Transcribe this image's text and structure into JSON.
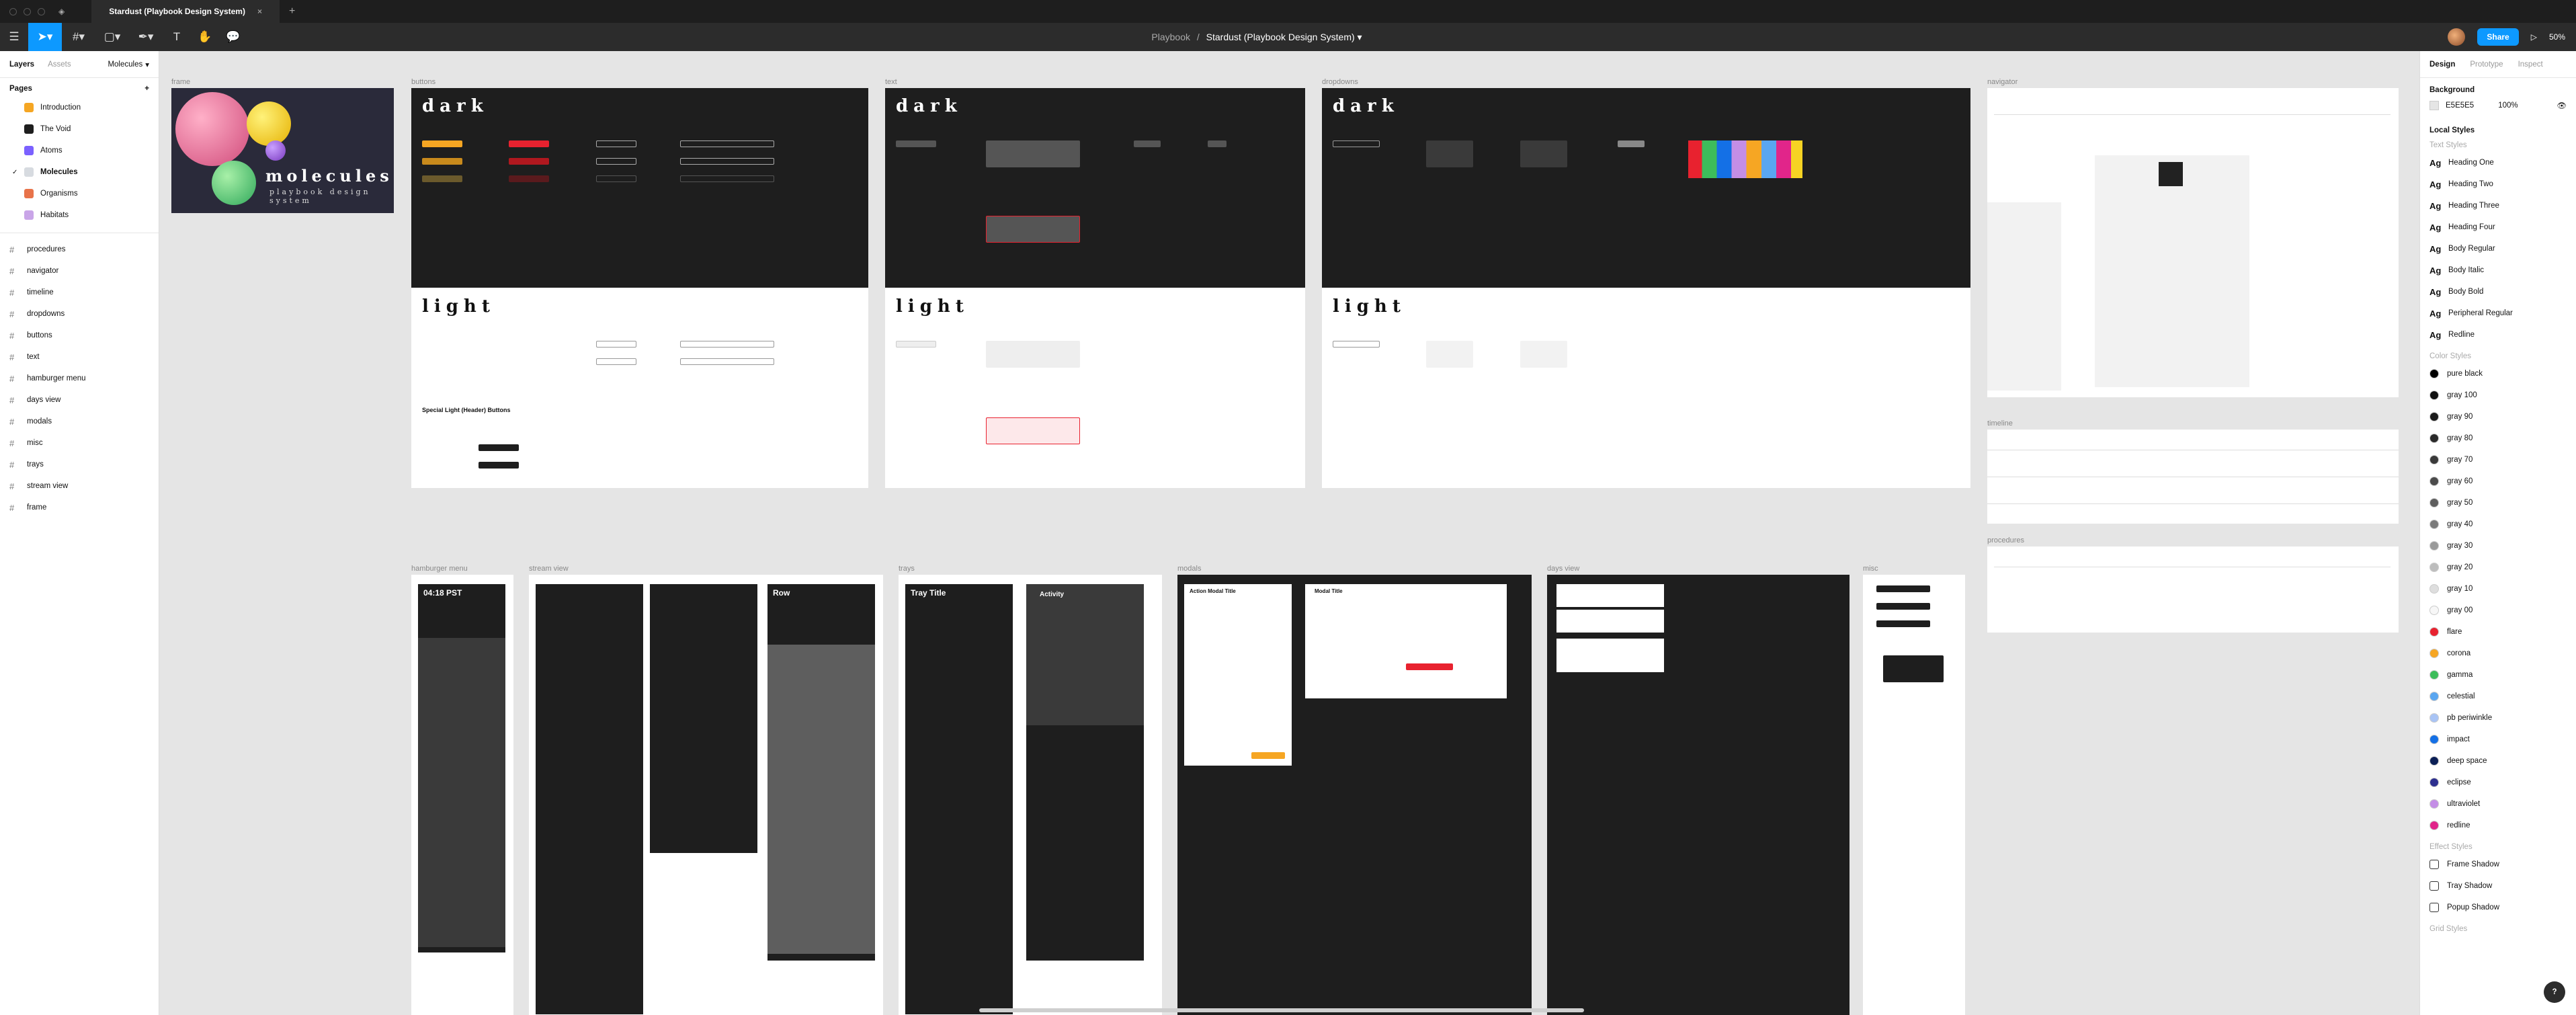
{
  "window": {
    "tab_title": "Stardust (Playbook Design System)",
    "breadcrumb_root": "Playbook",
    "breadcrumb_sep": "/",
    "file_name": "Stardust (Playbook Design System)",
    "share_label": "Share",
    "zoom": "50%"
  },
  "left_panel": {
    "tabs": [
      "Layers",
      "Assets"
    ],
    "page_selector": "Molecules",
    "pages_heading": "Pages",
    "pages": [
      {
        "label": "Introduction",
        "icon_color": "#f5a623"
      },
      {
        "label": "The Void",
        "icon_color": "#1e1e1e"
      },
      {
        "label": "Atoms",
        "icon_color": "#7b61ff"
      },
      {
        "label": "Molecules",
        "icon_color": "#d7dbe0"
      },
      {
        "label": "Organisms",
        "icon_color": "#e8734a"
      },
      {
        "label": "Habitats",
        "icon_color": "#c9a5e8"
      }
    ],
    "active_page": "Molecules",
    "layers": [
      "procedures",
      "navigator",
      "timeline",
      "dropdowns",
      "buttons",
      "text",
      "hamburger menu",
      "days view",
      "modals",
      "misc",
      "trays",
      "stream view",
      "frame"
    ]
  },
  "right_panel": {
    "tabs": [
      "Design",
      "Prototype",
      "Inspect"
    ],
    "background_heading": "Background",
    "background_hex": "E5E5E5",
    "background_opacity": "100%",
    "local_styles_heading": "Local Styles",
    "text_styles_heading": "Text Styles",
    "text_styles": [
      "Heading One",
      "Heading Two",
      "Heading Three",
      "Heading Four",
      "Body Regular",
      "Body Italic",
      "Body Bold",
      "Peripheral Regular",
      "Redline"
    ],
    "color_styles_heading": "Color Styles",
    "color_styles": [
      {
        "name": "pure black",
        "color": "#000000"
      },
      {
        "name": "gray 100",
        "color": "#101010"
      },
      {
        "name": "gray 90",
        "color": "#1b1b1b"
      },
      {
        "name": "gray 80",
        "color": "#2a2a2a"
      },
      {
        "name": "gray 70",
        "color": "#3a3a3a"
      },
      {
        "name": "gray 60",
        "color": "#4b4b4b"
      },
      {
        "name": "gray 50",
        "color": "#5e5e5e"
      },
      {
        "name": "gray 40",
        "color": "#7a7a7a"
      },
      {
        "name": "gray 30",
        "color": "#9a9a9a"
      },
      {
        "name": "gray 20",
        "color": "#bdbdbd"
      },
      {
        "name": "gray 10",
        "color": "#dedede"
      },
      {
        "name": "gray 00",
        "color": "#f7f7f7"
      },
      {
        "name": "flare",
        "color": "#e8222f"
      },
      {
        "name": "corona",
        "color": "#f6a623"
      },
      {
        "name": "gamma",
        "color": "#3dbd5b"
      },
      {
        "name": "celestial",
        "color": "#5aa6f0"
      },
      {
        "name": "pb periwinkle",
        "color": "#a9c4f5"
      },
      {
        "name": "impact",
        "color": "#1470e6"
      },
      {
        "name": "deep space",
        "color": "#0b1f56"
      },
      {
        "name": "eclipse",
        "color": "#2d2f8f"
      },
      {
        "name": "ultraviolet",
        "color": "#c48ee6"
      },
      {
        "name": "redline",
        "color": "#e1258a"
      }
    ],
    "effect_styles_heading": "Effect Styles",
    "effect_styles": [
      "Frame Shadow",
      "Tray Shadow",
      "Popup Shadow"
    ],
    "grid_styles_heading": "Grid Styles",
    "help_label": "?"
  },
  "canvas": {
    "frame_labels": {
      "frame": "frame",
      "buttons": "buttons",
      "text": "text",
      "dropdowns": "dropdowns",
      "navigator": "navigator",
      "timeline": "timeline",
      "procedures": "procedures",
      "hamburger": "hamburger menu",
      "stream": "stream view",
      "trays": "trays",
      "modals": "modals",
      "days": "days view",
      "misc": "misc"
    },
    "cover": {
      "title": "molecules",
      "subtitle": "playbook design system"
    },
    "theme_words": {
      "dark": "dark",
      "light": "light"
    },
    "hamburger_time": "04:18 PST",
    "tray_title": "Tray Title",
    "activity_title": "Activity",
    "row_title": "Row",
    "action_modal_title": "Action Modal Title",
    "modal_title": "Modal Title",
    "special_light_buttons": "Special Light (Header) Buttons"
  }
}
